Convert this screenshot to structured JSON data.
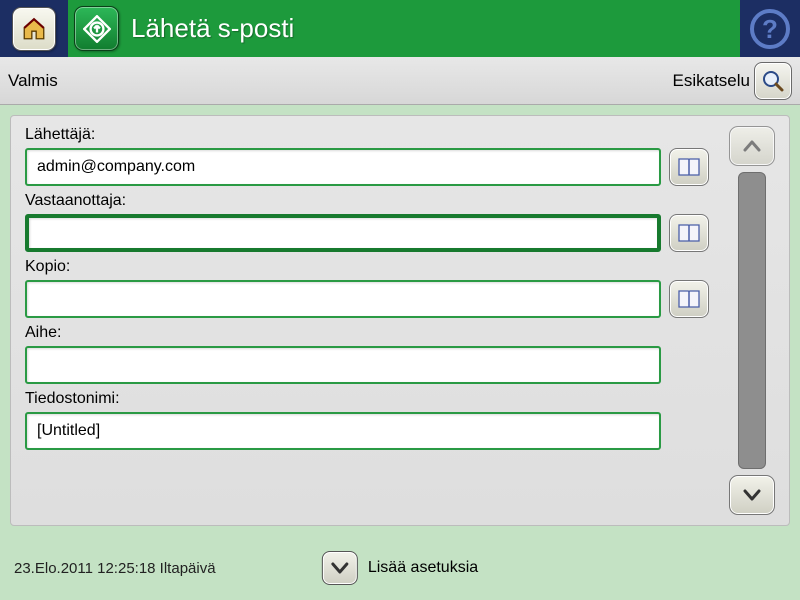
{
  "header": {
    "title": "Lähetä s-posti"
  },
  "status": {
    "left": "Valmis",
    "preview_label": "Esikatselu"
  },
  "fields": {
    "from": {
      "label": "Lähettäjä:",
      "value": "admin@company.com"
    },
    "to": {
      "label": "Vastaanottaja:",
      "value": ""
    },
    "cc": {
      "label": "Kopio:",
      "value": ""
    },
    "subject": {
      "label": "Aihe:",
      "value": ""
    },
    "filename": {
      "label": "Tiedostonimi:",
      "value": "[Untitled]"
    }
  },
  "footer": {
    "timestamp": "23.Elo.2011 12:25:18 Iltapäivä",
    "more_label": "Lisää asetuksia"
  },
  "colors": {
    "brand_green": "#1d9a3c",
    "brand_navy": "#1c2e63",
    "page_green": "#c4e2c4"
  }
}
